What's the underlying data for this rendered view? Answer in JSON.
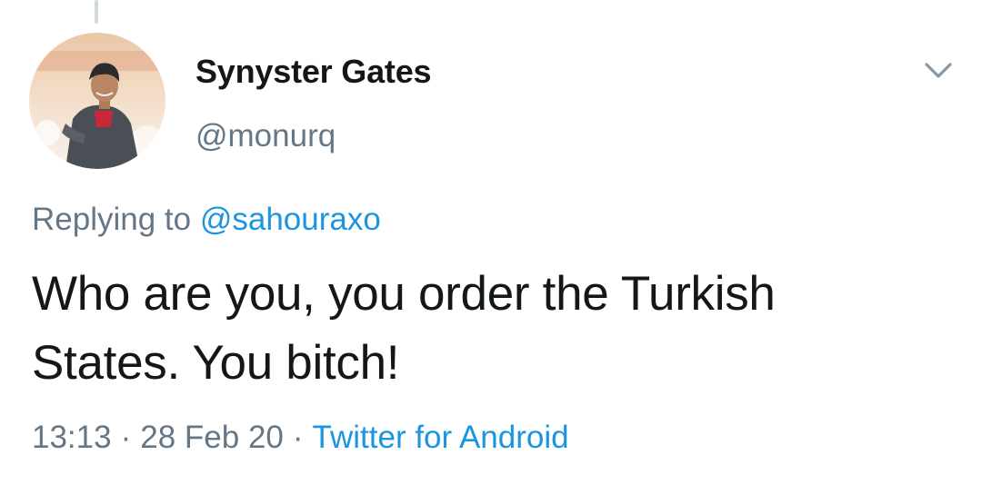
{
  "tweet": {
    "user": {
      "display_name": "Synyster Gates",
      "handle": "@monurq"
    },
    "replying_to_prefix": "Replying to",
    "replying_to_handle": "@sahouraxo",
    "text_line_1": "Who are you, you order the Turkish",
    "text_line_2": "States. You bitch!",
    "time": "13:13",
    "date": "28 Feb 20",
    "separator": "·",
    "source": "Twitter for Android"
  },
  "icons": {
    "menu": "chevron-down-icon",
    "avatar": "avatar"
  },
  "colors": {
    "link": "#1b95e0",
    "secondary_text": "#657786",
    "primary_text": "#14171a",
    "thread_line": "#cfd9de"
  }
}
